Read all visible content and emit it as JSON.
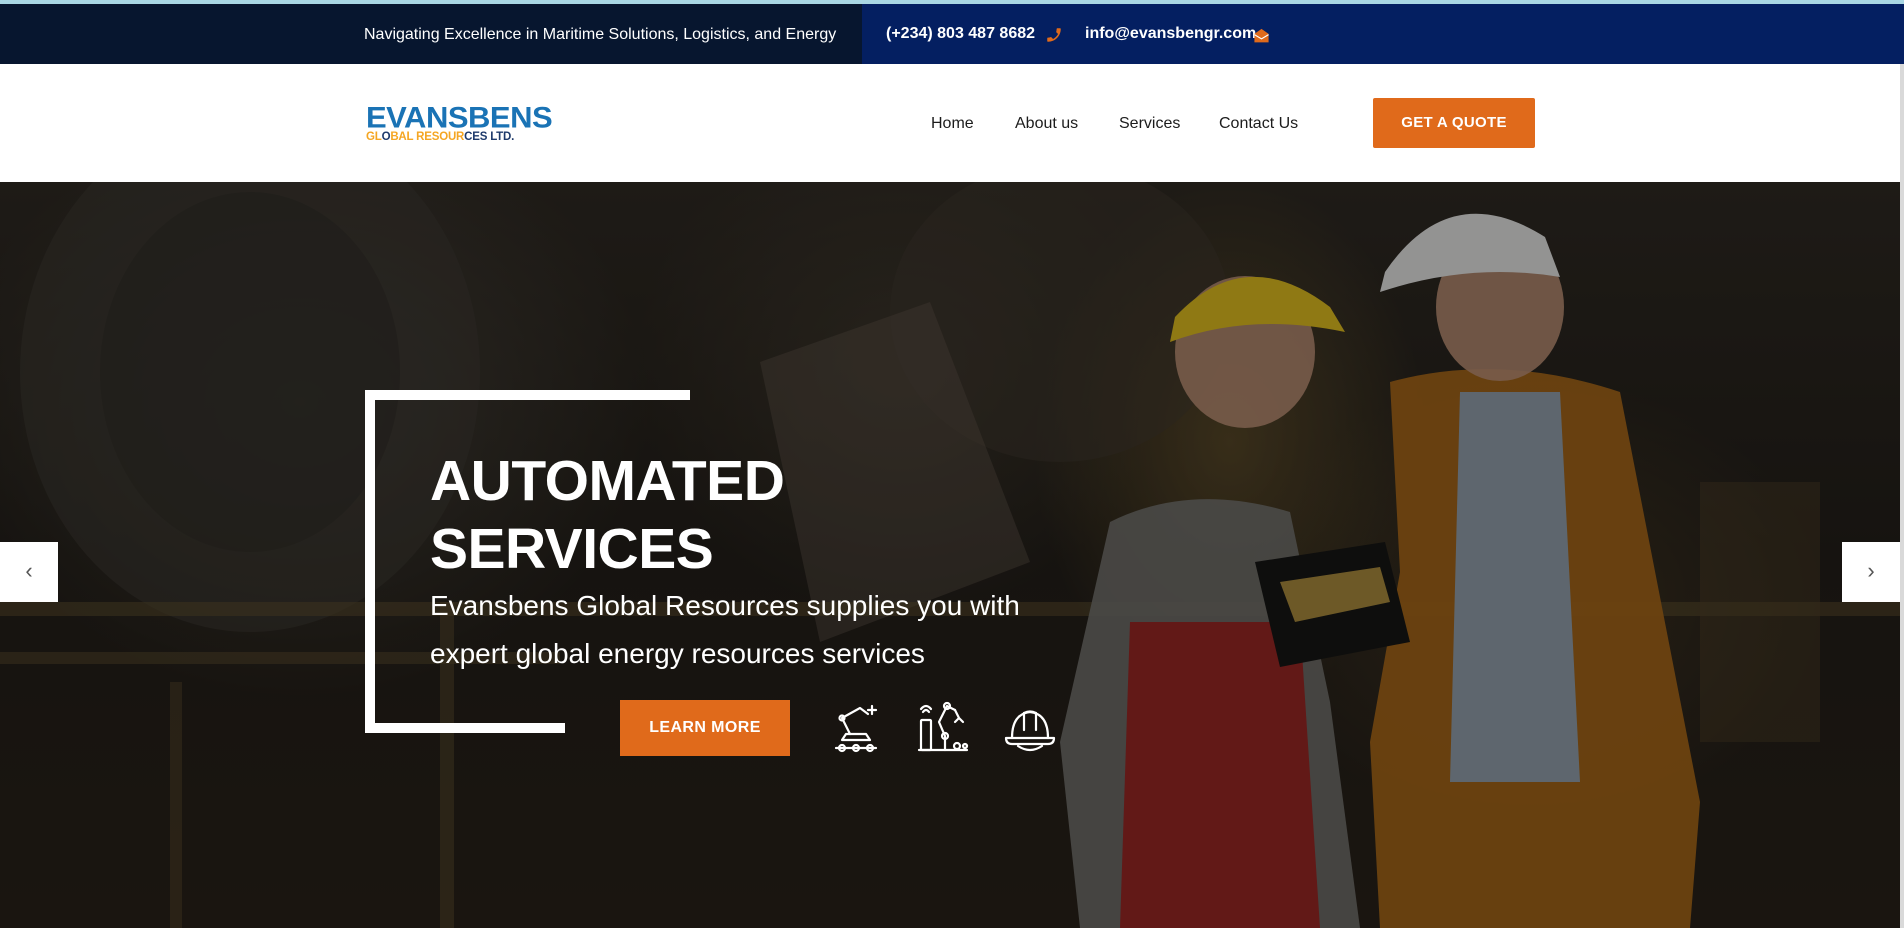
{
  "topbar": {
    "tagline": "Navigating Excellence in Maritime Solutions, Logistics, and Energy",
    "phone": "(+234) 803 487 8682",
    "email": "info@evansbengr.com",
    "phone_icon": "phone-icon",
    "email_icon": "envelope-icon",
    "colors": {
      "left_bg": "#07162f",
      "right_bg": "#041f61",
      "icon": "#e06a1b"
    }
  },
  "header": {
    "logo_line1": "EVANSBENS",
    "logo_line2_a": "GL",
    "logo_line2_b": "O",
    "logo_line2_c": "BAL RESOUR",
    "logo_line2_d": "CES LTD.",
    "nav": [
      {
        "label": "Home"
      },
      {
        "label": "About us"
      },
      {
        "label": "Services"
      },
      {
        "label": "Contact Us"
      }
    ],
    "quote_button": "GET A QUOTE"
  },
  "hero": {
    "title_line1": "AUTOMATED",
    "title_line2": "SERVICES",
    "subtitle": "Evansbens Global Resources supplies you with expert global energy resources services",
    "cta": "LEARN MORE",
    "icons": [
      "robot-arm-conveyor-icon",
      "industrial-robot-icon",
      "hard-hat-icon"
    ],
    "prev_arrow": "‹",
    "next_arrow": "›"
  },
  "colors": {
    "accent": "#e06a1b",
    "brand_blue": "#1a73b5",
    "brand_yellow": "#f5a623"
  }
}
